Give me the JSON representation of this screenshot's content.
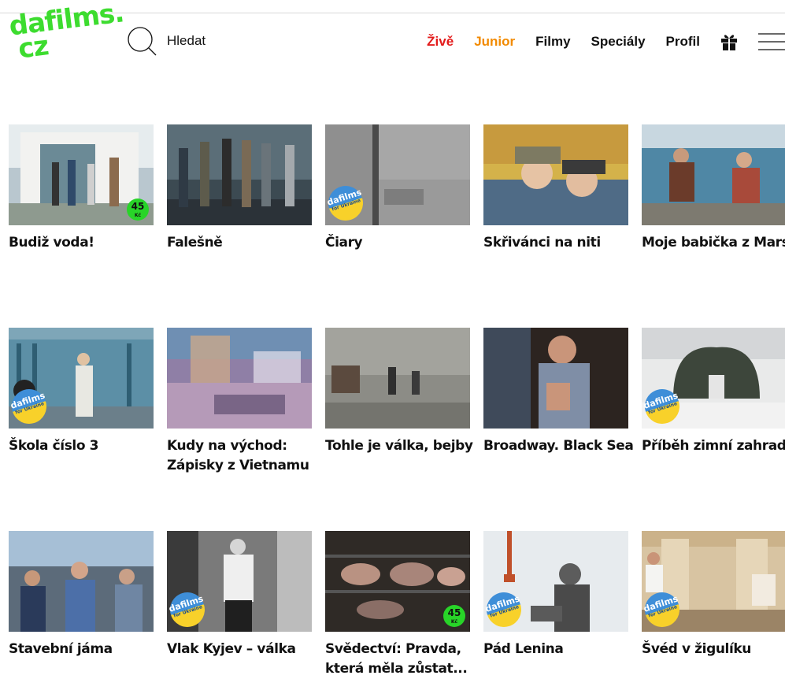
{
  "logo": {
    "line1": "dafilms.",
    "line2": "cz"
  },
  "search": {
    "placeholder": "Hledat"
  },
  "nav": {
    "live": "Živě",
    "junior": "Junior",
    "films": "Filmy",
    "specials": "Speciály",
    "profile": "Profil"
  },
  "badges": {
    "price_value": "45",
    "price_currency": "Kč",
    "ukraine_line1": "dafilms",
    "ukraine_line2": "for Ukraine"
  },
  "films": [
    {
      "title": "Budiž voda!"
    },
    {
      "title": "Falešně"
    },
    {
      "title": "Čiary"
    },
    {
      "title": "Skřivánci na niti"
    },
    {
      "title": "Moje babička z Marsu"
    },
    {
      "title": "Škola číslo 3"
    },
    {
      "title": "Kudy na východ: Zápisky z Vietnamu"
    },
    {
      "title": "Tohle je válka, bejby"
    },
    {
      "title": "Broadway. Black Sea"
    },
    {
      "title": "Příběh zimní zahrady"
    },
    {
      "title": "Stavební jáma"
    },
    {
      "title": "Vlak Kyjev – válka"
    },
    {
      "title": "Svědectví: Pravda, která měla zůstat..."
    },
    {
      "title": "Pád Lenina"
    },
    {
      "title": "Švéd v žigulíku"
    }
  ],
  "colors": {
    "brand_green": "#3ddc2f",
    "live_red": "#e31b1b",
    "junior_orange": "#f28a00"
  }
}
